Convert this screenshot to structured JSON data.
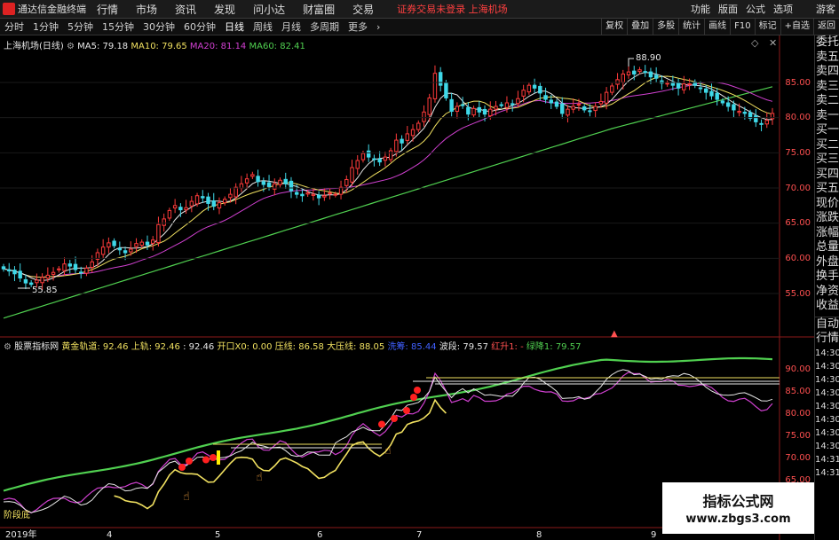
{
  "app": {
    "title": "通达信金融终端"
  },
  "menu": [
    "行情",
    "市场",
    "资讯",
    "发现",
    "问小达",
    "财富圈",
    "交易"
  ],
  "login_warning": "证券交易未登录  上海机场",
  "menu_right": [
    "功能",
    "版面",
    "公式",
    "选项",
    "游客"
  ],
  "timeframes": [
    "分时",
    "1分钟",
    "5分钟",
    "15分钟",
    "30分钟",
    "60分钟",
    "日线",
    "周线",
    "月线",
    "多周期",
    "更多"
  ],
  "active_timeframe": "日线",
  "tools_right": [
    "复权",
    "叠加",
    "多股",
    "统计",
    "画线",
    "F10",
    "标记",
    "+自选",
    "返回"
  ],
  "price_panel": {
    "stock_title": "上海机场(日线)",
    "ma": [
      {
        "label": "MA5: 79.18",
        "color": "#e8e8e8"
      },
      {
        "label": "MA10: 79.65",
        "color": "#f0e060"
      },
      {
        "label": "MA20: 81.14",
        "color": "#d040d0"
      },
      {
        "label": "MA60: 82.41",
        "color": "#50d050"
      }
    ],
    "y_ticks": [
      "85.00",
      "80.00",
      "75.00",
      "70.00",
      "65.00",
      "60.00",
      "55.00"
    ],
    "high_label": "88.90",
    "low_label": "55.85"
  },
  "indicator_panel": {
    "name": "股票指标网",
    "legend": [
      {
        "label": "黄金轨道: 92.46",
        "color": "#f0e060"
      },
      {
        "label": "上轨: 92.46",
        "color": "#f0e060"
      },
      {
        "label": ": 92.46",
        "color": "#e8e8e8"
      },
      {
        "label": "开口X0: 0.00",
        "color": "#f0e060"
      },
      {
        "label": "压线: 86.58",
        "color": "#f0e060"
      },
      {
        "label": "大压线: 88.05",
        "color": "#f0e060"
      },
      {
        "label": "洗筹: 85.44",
        "color": "#4060ff"
      },
      {
        "label": "波段: 79.57",
        "color": "#e8e8e8"
      },
      {
        "label": "红升1: -",
        "color": "#ff5050"
      },
      {
        "label": "绿降1: 79.57",
        "color": "#50d050"
      }
    ],
    "y_ticks": [
      "90.00",
      "85.00",
      "80.00",
      "75.00",
      "70.00",
      "65.00"
    ],
    "bottom_label": "阶段底"
  },
  "x_axis": [
    "2019年",
    "4",
    "5",
    "6",
    "7",
    "8",
    "9"
  ],
  "side_panel": {
    "items": [
      "委托",
      "卖五",
      "卖四",
      "卖三",
      "卖二",
      "卖一",
      "买一",
      "买二",
      "买三",
      "买四",
      "买五",
      "现价",
      "涨跌",
      "涨幅",
      "总量",
      "外盘",
      "换手",
      "净资",
      "收益",
      "自动",
      "行情",
      "14:30",
      "14:30",
      "14:30",
      "14:30",
      "14:30",
      "14:30",
      "14:30",
      "14:30",
      "14:31",
      "14:31"
    ]
  },
  "watermark": {
    "title": "指标公式网",
    "url": "www.zbgs3.com"
  },
  "chart_data": {
    "type": "candlestick",
    "closes": [
      58.5,
      58.2,
      57.8,
      57.2,
      56.5,
      56.3,
      56.9,
      57.3,
      57.6,
      58.0,
      58.5,
      59.2,
      58.9,
      58.4,
      58.0,
      58.6,
      59.5,
      60.8,
      61.6,
      62.2,
      61.8,
      61.2,
      60.8,
      61.3,
      62.1,
      62.3,
      61.9,
      62.6,
      64.8,
      65.6,
      66.8,
      67.5,
      66.9,
      67.2,
      68.1,
      68.9,
      68.6,
      67.8,
      67.4,
      67.9,
      68.4,
      69.1,
      70.1,
      70.6,
      71.3,
      71.9,
      70.9,
      70.5,
      70.2,
      70.6,
      71.1,
      70.6,
      69.6,
      69.1,
      68.9,
      69.3,
      69.1,
      68.6,
      68.9,
      69.3,
      69.1,
      70.1,
      71.2,
      72.9,
      73.9,
      74.9,
      74.4,
      74.1,
      73.7,
      74.4,
      75.3,
      76.8,
      76.4,
      77.7,
      78.3,
      79.2,
      80.8,
      82.8,
      86.3,
      84.6,
      82.8,
      80.9,
      81.6,
      81.8,
      80.5,
      81.3,
      80.8,
      80.5,
      81.2,
      81.6,
      81.8,
      82.1,
      81.9,
      82.7,
      83.9,
      84.6,
      84.2,
      83.5,
      82.6,
      82.1,
      81.6,
      80.6,
      81.2,
      81.6,
      81.9,
      81.1,
      80.9,
      81.6,
      82.3,
      83.6,
      84.5,
      85.4,
      86.2,
      86.5,
      86.2,
      86.8,
      86.5,
      85.8,
      85.6,
      84.9,
      84.9,
      84.6,
      84.2,
      84.8,
      84.8,
      84.6,
      84.2,
      83.6,
      83.1,
      82.6,
      82.1,
      81.6,
      81.1,
      80.9,
      80.6,
      79.9,
      79.4,
      79.1,
      79.6,
      80.6
    ],
    "indicator_series": [
      {
        "name": "上轨",
        "color": "#50d050",
        "y_start": 62.5,
        "y_end": 92.0
      },
      {
        "name": "波段",
        "color": "#e8e8e8",
        "y_end": 79.57
      }
    ]
  }
}
